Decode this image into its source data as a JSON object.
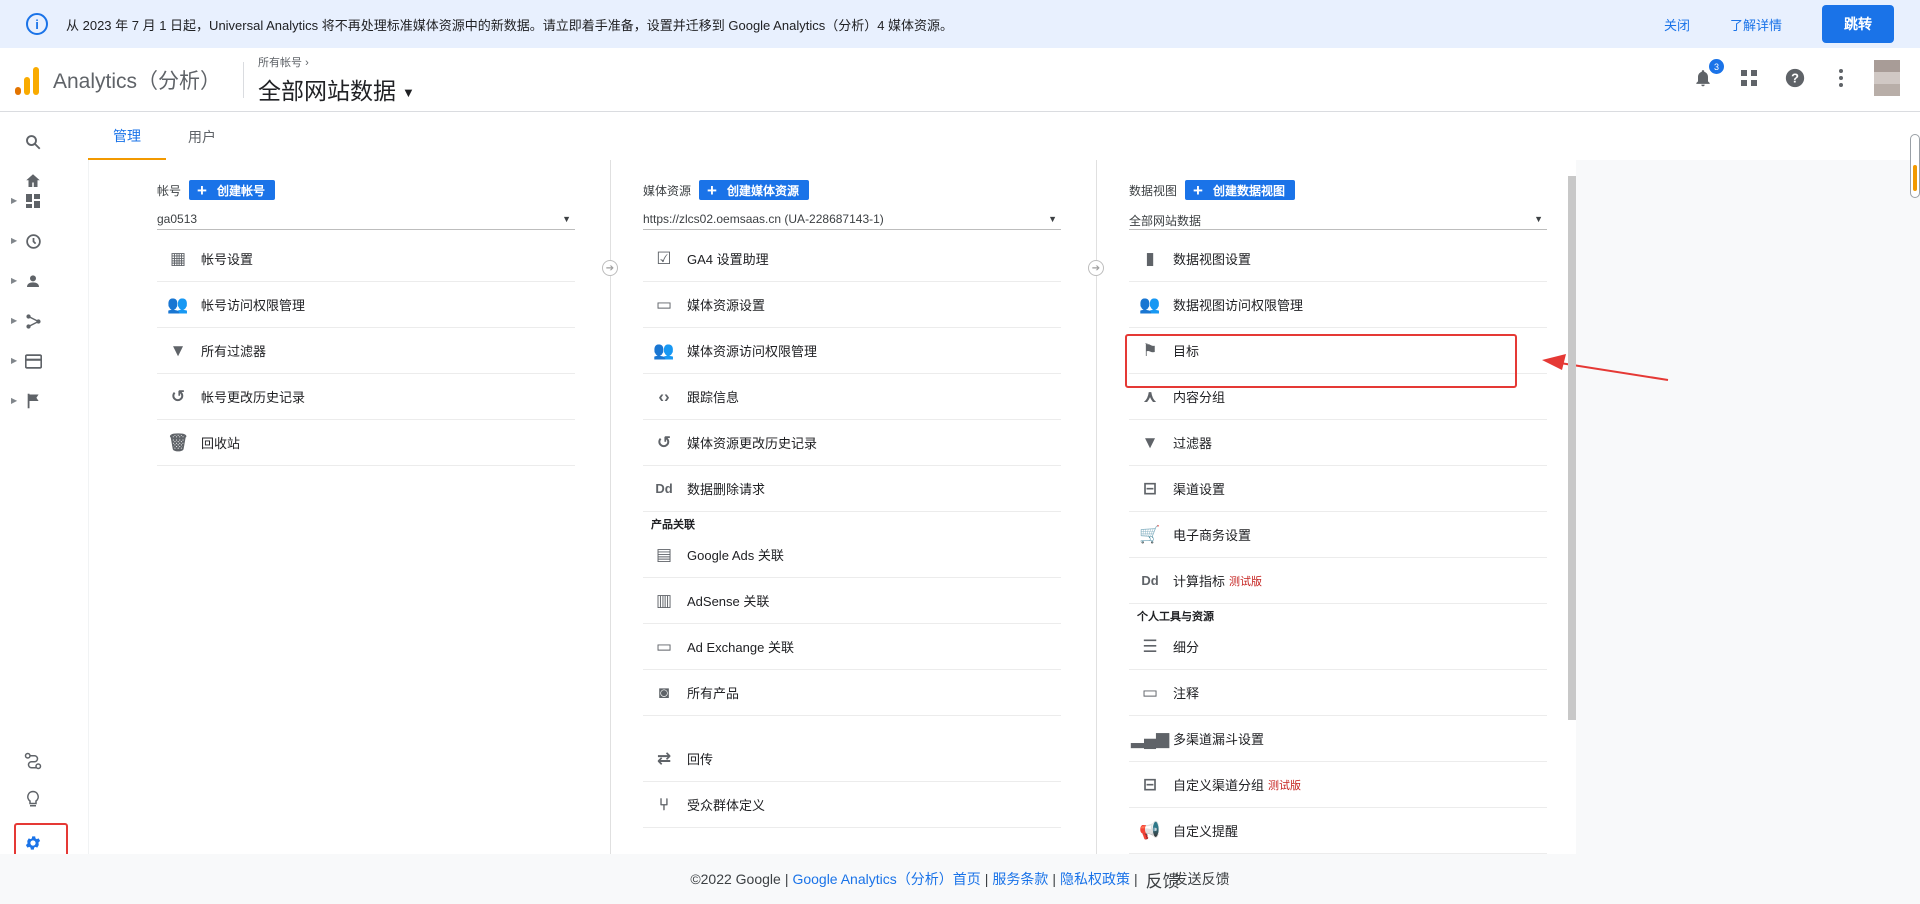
{
  "banner": {
    "info_icon": "i",
    "message": "从 2023 年 7 月 1 日起，Universal Analytics 将不再处理标准媒体资源中的新数据。请立即着手准备，设置并迁移到 Google Analytics（分析）4 媒体资源。",
    "close": "关闭",
    "learn_more": "了解详情",
    "go": "跳转"
  },
  "header": {
    "app_title": "Analytics（分析）",
    "all_accounts_label": "所有帐号 ›",
    "view_name": "全部网站数据",
    "notification_count": "3"
  },
  "tabs": {
    "admin": "管理",
    "user": "用户"
  },
  "account": {
    "header": "帐号",
    "create": "创建帐号",
    "selected": "ga0513",
    "items": [
      {
        "label": "帐号设置",
        "icon": "building-icon"
      },
      {
        "label": "帐号访问权限管理",
        "icon": "people-icon"
      },
      {
        "label": "所有过滤器",
        "icon": "filter-icon"
      },
      {
        "label": "帐号更改历史记录",
        "icon": "history-icon"
      },
      {
        "label": "回收站",
        "icon": "trash-icon"
      }
    ]
  },
  "property": {
    "header": "媒体资源",
    "create": "创建媒体资源",
    "selected": "https://zlcs02.oemsaas.cn (UA-228687143-1)",
    "items": [
      {
        "label": "GA4 设置助理",
        "icon": "checkbox-icon"
      },
      {
        "label": "媒体资源设置",
        "icon": "layout-icon"
      },
      {
        "label": "媒体资源访问权限管理",
        "icon": "people-icon"
      },
      {
        "label": "跟踪信息",
        "icon": "code-icon"
      },
      {
        "label": "媒体资源更改历史记录",
        "icon": "history-icon"
      },
      {
        "label": "数据删除请求",
        "icon": "dd-icon"
      }
    ],
    "section_title": "产品关联",
    "links": [
      {
        "label": "Google Ads 关联",
        "icon": "ads-icon"
      },
      {
        "label": "AdSense 关联",
        "icon": "adsense-icon"
      },
      {
        "label": "Ad Exchange 关联",
        "icon": "adexchange-icon"
      },
      {
        "label": "所有产品",
        "icon": "products-icon"
      }
    ],
    "extra": [
      {
        "label": "回传",
        "icon": "postback-icon"
      },
      {
        "label": "受众群体定义",
        "icon": "audience-icon"
      }
    ]
  },
  "view": {
    "header": "数据视图",
    "create": "创建数据视图",
    "selected": "全部网站数据",
    "items": [
      {
        "label": "数据视图设置",
        "icon": "document-icon"
      },
      {
        "label": "数据视图访问权限管理",
        "icon": "people-icon"
      },
      {
        "label": "目标",
        "icon": "flag-icon"
      },
      {
        "label": "内容分组",
        "icon": "grouping-icon"
      },
      {
        "label": "过滤器",
        "icon": "filter-icon"
      },
      {
        "label": "渠道设置",
        "icon": "channel-icon"
      },
      {
        "label": "电子商务设置",
        "icon": "cart-icon"
      },
      {
        "label": "计算指标",
        "icon": "dd-icon",
        "beta": "测试版"
      }
    ],
    "section_title": "个人工具与资源",
    "tools": [
      {
        "label": "细分",
        "icon": "segments-icon"
      },
      {
        "label": "注释",
        "icon": "comment-icon"
      },
      {
        "label": "多渠道漏斗设置",
        "icon": "bar-chart-icon"
      },
      {
        "label": "自定义渠道分组",
        "icon": "channel-icon",
        "beta": "测试版"
      },
      {
        "label": "自定义提醒",
        "icon": "megaphone-icon"
      }
    ]
  },
  "footer": {
    "copyright": "©2022 Google",
    "home": "Google Analytics（分析）首页",
    "terms": "服务条款",
    "privacy": "隐私权政策",
    "feedback": "发送反馈",
    "feedback_overlay": "反馈"
  }
}
